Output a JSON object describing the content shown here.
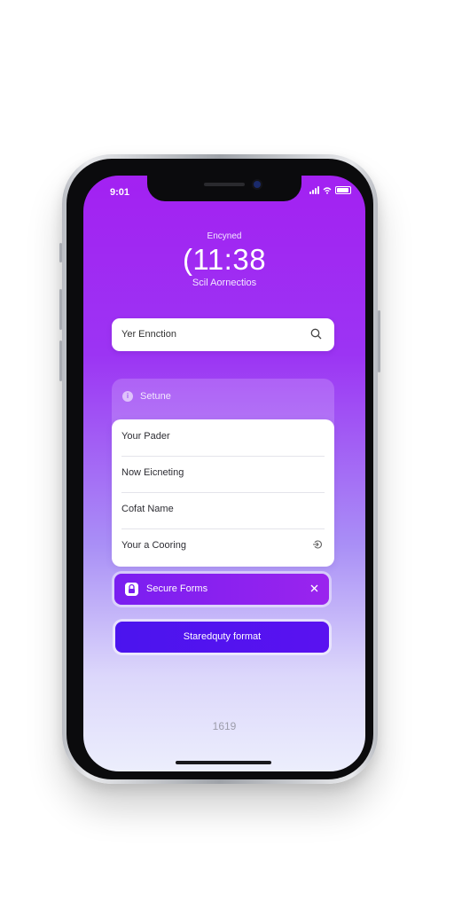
{
  "status_bar": {
    "time": "9:01"
  },
  "lock": {
    "label": "Encyned",
    "time": "(11:38",
    "subtitle": "Scil Aornectios"
  },
  "search": {
    "value": "Yer Ennction"
  },
  "secure_section": {
    "title": "Setune"
  },
  "form": {
    "rows": [
      {
        "label": "Your Pader"
      },
      {
        "label": "Now Eicneting"
      },
      {
        "label": "Cofat Name"
      },
      {
        "label": "Your a Cooring"
      }
    ]
  },
  "secure_forms": {
    "label": "Secure Forms"
  },
  "primary_button": {
    "label": "Staredquty format"
  },
  "footer": {
    "page_number": "1619"
  },
  "colors": {
    "gradient_top": "#a321f2",
    "gradient_bottom": "#eceefc",
    "secure_forms_bg": "#8a21ef",
    "primary_button_bg": "#5012ef"
  },
  "icons": [
    "signal-icon",
    "wifi-icon",
    "battery-icon",
    "search-icon",
    "info-icon",
    "arrow-icon",
    "lock-icon",
    "close-icon"
  ]
}
